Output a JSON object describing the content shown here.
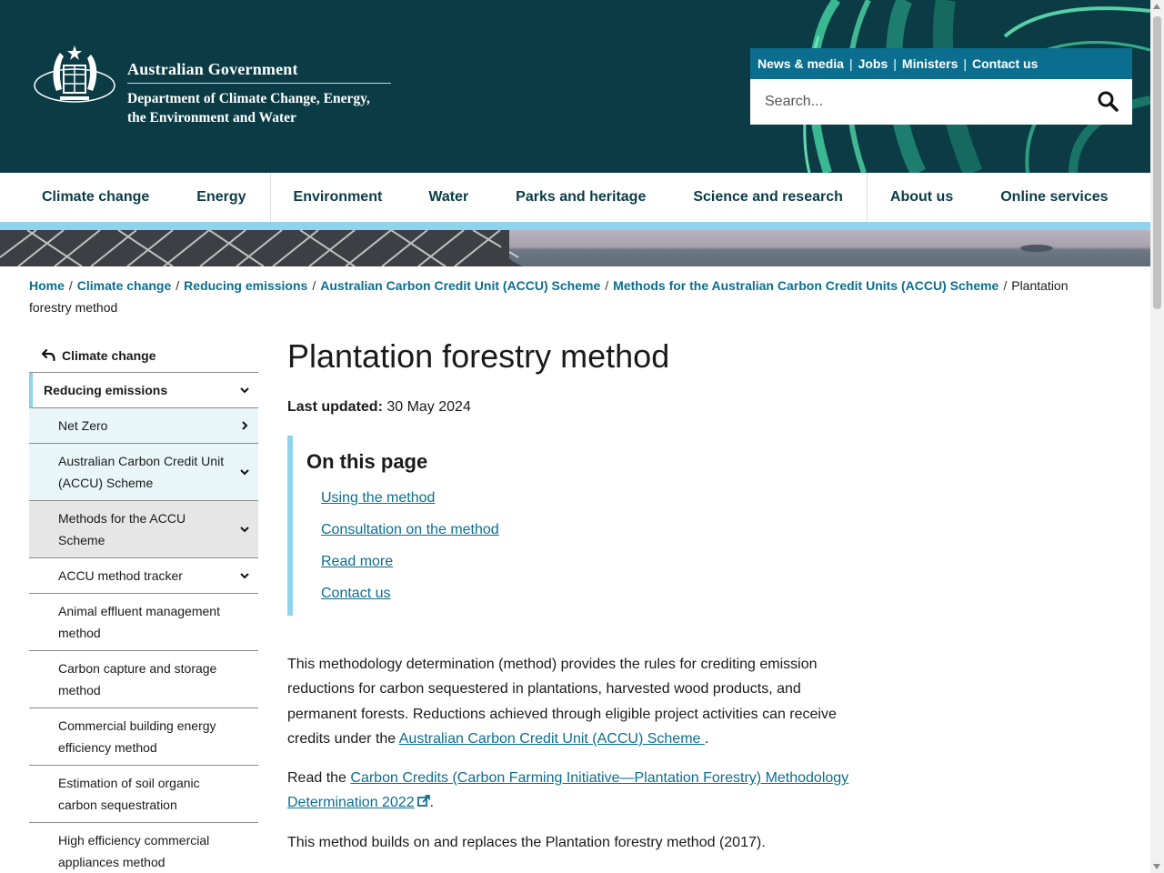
{
  "header": {
    "gov_name": "Australian Government",
    "dept_line1": "Department of Climate Change, Energy,",
    "dept_line2": "the Environment and Water"
  },
  "utility_nav": [
    "News & media",
    "Jobs",
    "Ministers",
    "Contact us"
  ],
  "search": {
    "placeholder": "Search..."
  },
  "main_nav": [
    "Climate change",
    "Energy",
    "Environment",
    "Water",
    "Parks and heritage",
    "Science and research",
    "About us",
    "Online services"
  ],
  "breadcrumb": {
    "links": [
      "Home",
      "Climate change",
      "Reducing emissions",
      "Australian Carbon Credit Unit (ACCU) Scheme",
      "Methods for the Australian Carbon Credit Units (ACCU) Scheme"
    ],
    "current": "Plantation forestry method"
  },
  "sidebar": {
    "back": "Climate change",
    "items": [
      {
        "label": "Reducing emissions",
        "chevron": "down"
      },
      {
        "label": "Net Zero",
        "chevron": "right"
      },
      {
        "label": "Australian Carbon Credit Unit (ACCU) Scheme",
        "chevron": "down"
      },
      {
        "label": "Methods for the ACCU Scheme",
        "chevron": "down"
      },
      {
        "label": "ACCU method tracker",
        "chevron": "down"
      },
      {
        "label": "Animal effluent management method"
      },
      {
        "label": "Carbon capture and storage method"
      },
      {
        "label": "Commercial building energy efficiency method"
      },
      {
        "label": "Estimation of soil organic carbon sequestration"
      },
      {
        "label": "High efficiency commercial appliances method"
      }
    ]
  },
  "content": {
    "title": "Plantation forestry method",
    "updated_label": "Last updated:",
    "updated_value": " 30 May 2024",
    "toc_title": "On this page",
    "toc": [
      "Using the method",
      "Consultation on the method",
      "Read more",
      "Contact us"
    ],
    "p1_text": "This methodology determination (method) provides the rules for crediting emission reductions for carbon sequestered in plantations, harvested wood products, and permanent forests. Reductions achieved through eligible project activities can receive credits under the ",
    "p1_link": "Australian Carbon Credit Unit (ACCU) Scheme ",
    "p1_end": ".",
    "p2_text": "Read the ",
    "p2_link": "Carbon Credits (Carbon Farming Initiative—Plantation Forestry) Methodology Determination 2022",
    "p2_end": ".",
    "p3_text": "This method builds on and replaces the Plantation forestry method (2017)."
  },
  "colors": {
    "header_bg": "#0b3c45",
    "accent_blue": "#0c6e8e",
    "light_blue": "#8fd3ef",
    "sidebar_tint": "#e9f6f9"
  }
}
